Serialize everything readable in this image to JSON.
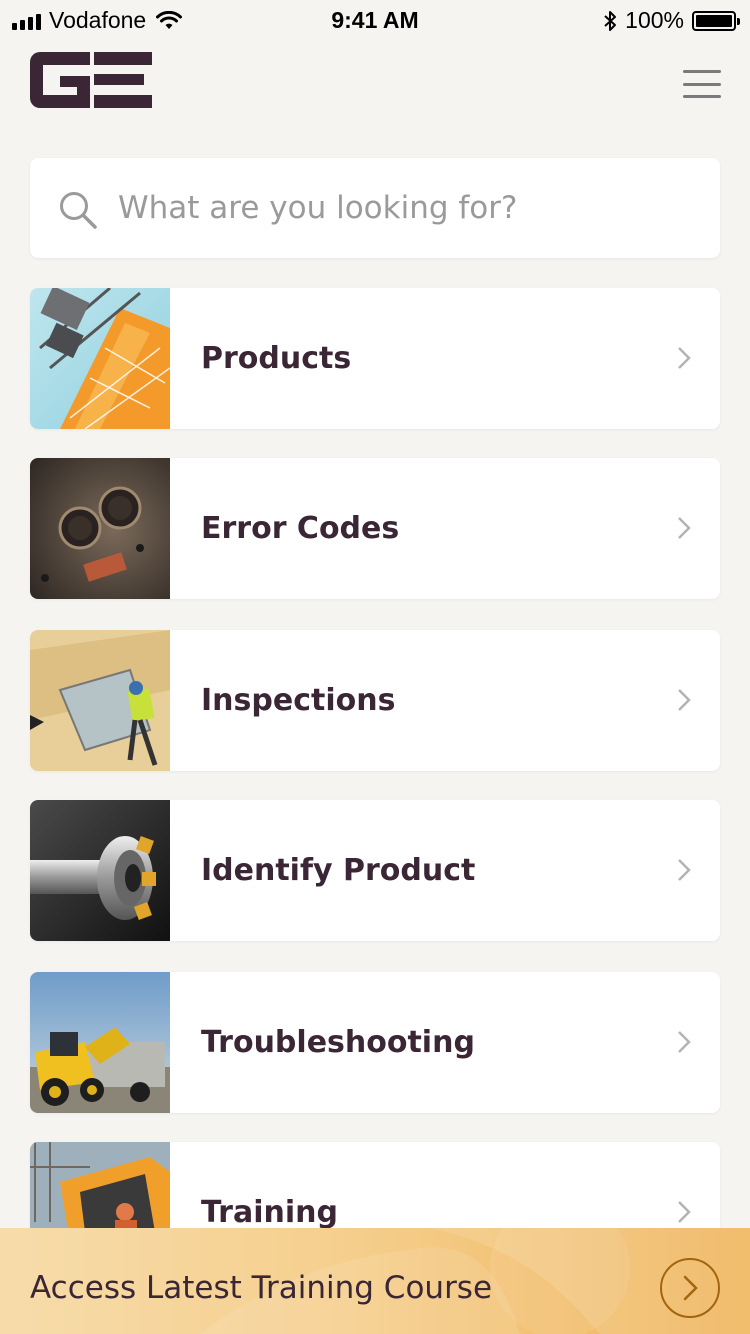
{
  "status_bar": {
    "carrier": "Vodafone",
    "time": "9:41 AM",
    "battery_text": "100%",
    "battery_level": 1.0
  },
  "header": {
    "logo_icon": "ge-logo",
    "menu_icon": "hamburger-menu-icon"
  },
  "search": {
    "placeholder": "What are you looking for?",
    "value": "",
    "icon": "search-icon"
  },
  "menu": {
    "items": [
      {
        "label": "Products",
        "thumb": "tower-crane-photo"
      },
      {
        "label": "Error Codes",
        "thumb": "rusty-machine-knobs-photo"
      },
      {
        "label": "Inspections",
        "thumb": "construction-worker-photo"
      },
      {
        "label": "Identify Product",
        "thumb": "milling-cutter-photo"
      },
      {
        "label": "Troubleshooting",
        "thumb": "wheel-loader-photo"
      },
      {
        "label": "Training",
        "thumb": "excavator-cab-photo"
      }
    ]
  },
  "banner": {
    "label": "Access Latest Training Course",
    "icon": "chevron-right-circle-icon"
  },
  "colors": {
    "background": "#f5f4f1",
    "text": "#3b2636",
    "accent": "#f0b75f",
    "chevron": "#b3b3b3"
  }
}
